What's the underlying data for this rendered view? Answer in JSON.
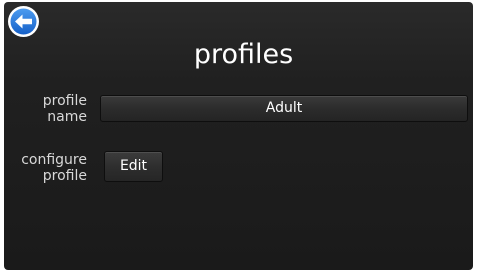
{
  "header": {
    "back_icon": "back-arrow-icon",
    "title": "profiles"
  },
  "profile_name": {
    "label": "profile\nname",
    "value": "Adult"
  },
  "configure_profile": {
    "label": "configure\nprofile",
    "button_label": "Edit"
  },
  "colors": {
    "background": "#1f1f1f",
    "back_button_fill": "#1a6fd6",
    "text": "#ffffff"
  }
}
